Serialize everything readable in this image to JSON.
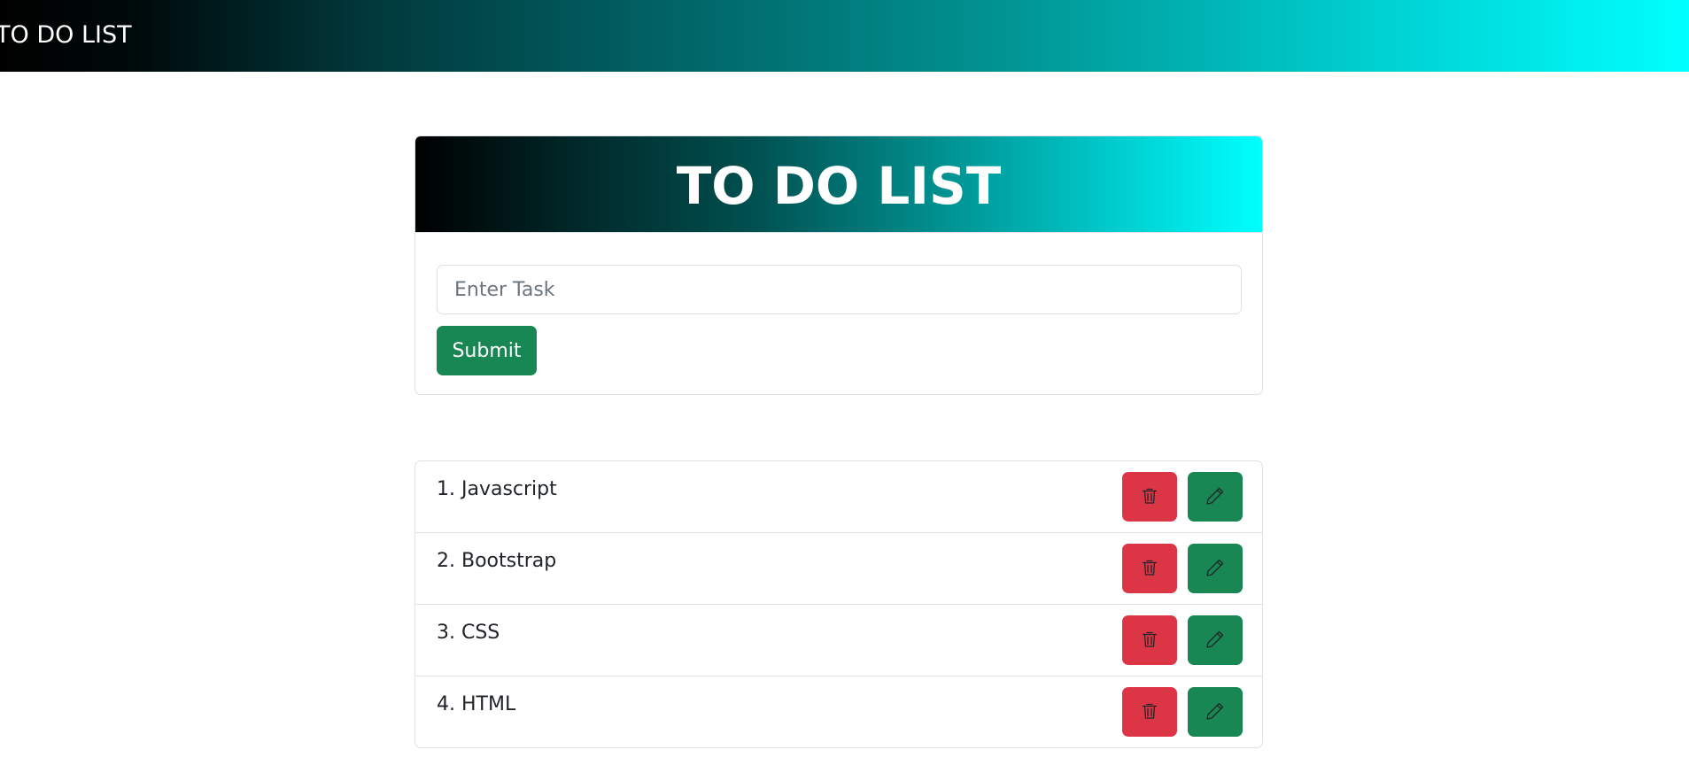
{
  "navbar": {
    "brand": "TO DO LIST"
  },
  "card": {
    "title": "TO DO LIST",
    "input": {
      "placeholder": "Enter Task",
      "value": ""
    },
    "submit_label": "Submit"
  },
  "tasks": [
    {
      "label": "1. Javascript",
      "delete_icon": "trash-icon",
      "edit_icon": "pencil-icon"
    },
    {
      "label": "2. Bootstrap",
      "delete_icon": "trash-icon",
      "edit_icon": "pencil-icon"
    },
    {
      "label": "3. CSS",
      "delete_icon": "trash-icon",
      "edit_icon": "pencil-icon"
    },
    {
      "label": "4. HTML",
      "delete_icon": "trash-icon",
      "edit_icon": "pencil-icon"
    }
  ],
  "colors": {
    "gradient_start": "#000000",
    "gradient_end": "#00ffff",
    "success": "#198754",
    "danger": "#dc3545",
    "border": "#dee2e6"
  }
}
